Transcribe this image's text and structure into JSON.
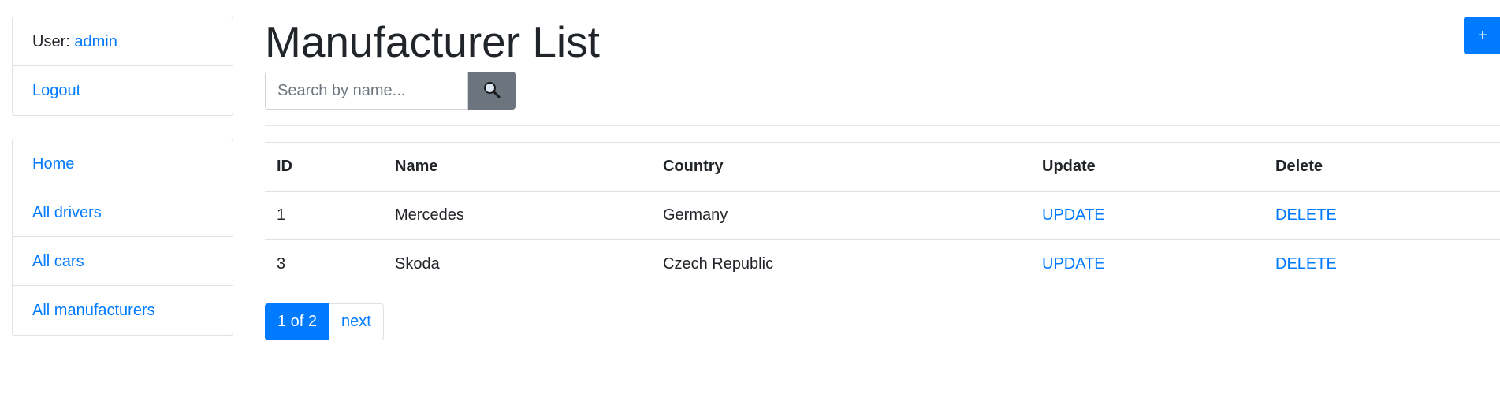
{
  "user_panel": {
    "user_label": "User:",
    "username": "admin",
    "logout": "Logout"
  },
  "nav": {
    "items": [
      {
        "label": "Home"
      },
      {
        "label": "All drivers"
      },
      {
        "label": "All cars"
      },
      {
        "label": "All manufacturers"
      }
    ]
  },
  "page": {
    "title": "Manufacturer List",
    "add_label": "+"
  },
  "search": {
    "placeholder": "Search by name...",
    "value": "",
    "button_icon": "search-icon"
  },
  "table": {
    "headers": [
      "ID",
      "Name",
      "Country",
      "Update",
      "Delete"
    ],
    "rows": [
      {
        "id": "1",
        "name": "Mercedes",
        "country": "Germany",
        "update": "UPDATE",
        "delete": "DELETE"
      },
      {
        "id": "3",
        "name": "Skoda",
        "country": "Czech Republic",
        "update": "UPDATE",
        "delete": "DELETE"
      }
    ]
  },
  "pagination": {
    "current": "1 of 2",
    "next": "next"
  },
  "colors": {
    "primary": "#007bff",
    "secondary": "#6c757d",
    "text": "#212529"
  }
}
